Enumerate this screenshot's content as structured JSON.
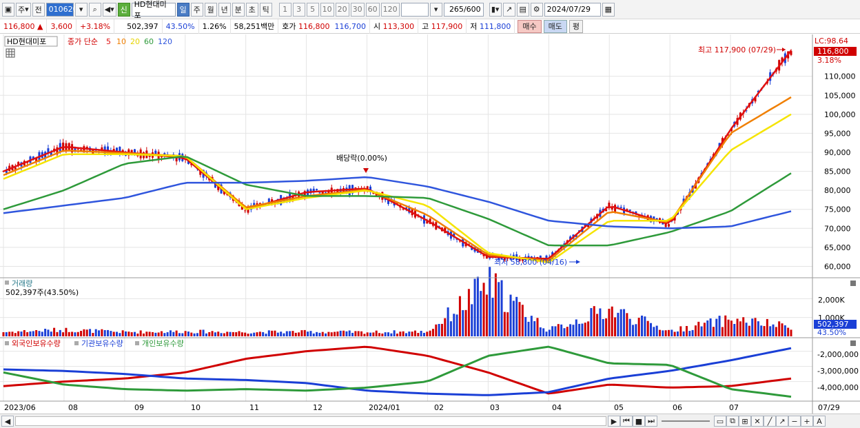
{
  "toolbar": {
    "market_type": "주",
    "prev_label": "전",
    "stock_code": "010620",
    "new_badge": "신",
    "stock_name": "HD현대미포",
    "periods": [
      "일",
      "주",
      "월",
      "년",
      "분",
      "초",
      "틱"
    ],
    "active_period": "일",
    "intervals": [
      "1",
      "3",
      "5",
      "10",
      "20",
      "30",
      "60",
      "120"
    ],
    "count_value": "265",
    "count_max": "/600",
    "date_value": "2024/07/29"
  },
  "quote": {
    "price": "116,800",
    "change_arrow": "▲",
    "change": "3,600",
    "change_pct": "+3.18%",
    "volume": "502,397",
    "volume_ratio": "43.50%",
    "turnover": "1.26%",
    "amount": "58,251백만",
    "ask_label": "호가",
    "ask1": "116,800",
    "ask2": "116,700",
    "open_label": "시",
    "open": "113,300",
    "high_label": "고",
    "high": "117,900",
    "low_label": "저",
    "low": "111,800",
    "buy_label": "매수",
    "sell_label": "매도",
    "flat_label": "평"
  },
  "price_panel": {
    "name_tag": "HD현대미포",
    "legend_prefix": "종가 단순",
    "ma_labels": [
      "5",
      "10",
      "20",
      "60",
      "120"
    ],
    "lc_label": "LC:98.64",
    "last_price_tag": "116,800",
    "last_pct_tag": "3.18%",
    "high_annotation": "최고 117,900 (07/29)",
    "low_annotation": "최저 58,800 (04/16)",
    "dividend_annotation": "배당락(0.00%)"
  },
  "volume_panel": {
    "title": "거래량",
    "value_line": "502,397주(43.50%)",
    "axis_ticks": [
      "2,000K",
      "1,000K"
    ],
    "last_tag": "502,397",
    "last_pct_tag": "43.50%"
  },
  "holding_panel": {
    "legend": [
      "외국인보유수량",
      "기관보유수량",
      "개인보유수량"
    ],
    "axis_ticks": [
      "-2,000,000",
      "-3,000,000",
      "-4,000,000"
    ]
  },
  "x_axis": {
    "labels": [
      "2023/06",
      "08",
      "09",
      "10",
      "11",
      "12",
      "2024/01",
      "02",
      "03",
      "04",
      "05",
      "06",
      "07"
    ],
    "current_label": "07/29"
  },
  "colors": {
    "up": "#d00000",
    "down": "#1a3fd6",
    "ma5": "#e01010",
    "ma10": "#f07f00",
    "ma20": "#f5e400",
    "ma60": "#2e9a3a",
    "ma120": "#2f55dd"
  },
  "chart_data": [
    {
      "type": "line",
      "title": "",
      "y_ticks": [
        60000,
        65000,
        70000,
        75000,
        80000,
        85000,
        90000,
        95000,
        100000,
        105000,
        110000
      ],
      "ylim": [
        57000,
        121000
      ],
      "x": [
        "2023/06",
        "08",
        "09",
        "10",
        "11",
        "12",
        "2024/01",
        "02",
        "03",
        "04",
        "05",
        "06",
        "07",
        "07/29"
      ],
      "series": [
        {
          "name": "5",
          "values": [
            85000,
            91500,
            90000,
            88500,
            75000,
            79500,
            80500,
            72000,
            62500,
            62000,
            76000,
            71000,
            96000,
            116800
          ]
        },
        {
          "name": "10",
          "values": [
            84000,
            90500,
            89800,
            89000,
            75500,
            78500,
            80200,
            73500,
            63000,
            61500,
            74500,
            71500,
            95000,
            104500
          ]
        },
        {
          "name": "20",
          "values": [
            83000,
            89500,
            89500,
            89000,
            75000,
            78000,
            80000,
            76000,
            63500,
            61000,
            72000,
            72000,
            90500,
            100000
          ]
        },
        {
          "name": "60",
          "values": [
            75000,
            80000,
            87000,
            89000,
            81500,
            78500,
            78500,
            78000,
            72500,
            65500,
            65500,
            69000,
            74500,
            84500
          ]
        },
        {
          "name": "120",
          "values": [
            74000,
            76000,
            78000,
            82000,
            82000,
            82500,
            83500,
            81000,
            77000,
            72000,
            70500,
            70000,
            70500,
            74500
          ]
        }
      ],
      "annotations": {
        "high": 117900,
        "low": 58800
      }
    },
    {
      "type": "bar",
      "title": "",
      "series_name": "",
      "y_ticks": [
        1000000,
        2000000
      ],
      "x": [
        "2023/06",
        "08",
        "09",
        "10",
        "11",
        "12",
        "2024/01",
        "02",
        "03",
        "04",
        "05",
        "06",
        "07",
        "07/29"
      ],
      "values": [
        230000,
        350000,
        230000,
        260000,
        230000,
        240000,
        220000,
        250000,
        2800000,
        320000,
        1450000,
        280000,
        900000,
        502397
      ]
    },
    {
      "type": "line",
      "title": "",
      "y_ticks": [
        -2000000,
        -3000000,
        -4000000
      ],
      "ylim": [
        -5200000,
        -1200000
      ],
      "x": [
        "2023/06",
        "08",
        "09",
        "10",
        "11",
        "12",
        "2024/01",
        "02",
        "03",
        "04",
        "05",
        "06",
        "07",
        "07/29"
      ],
      "series": [
        {
          "name": "외국인보유수량",
          "values": [
            -4300000,
            -4000000,
            -3800000,
            -3400000,
            -2500000,
            -2000000,
            -1700000,
            -2300000,
            -3400000,
            -4800000,
            -4200000,
            -4400000,
            -4300000,
            -3800000
          ]
        },
        {
          "name": "기관보유수량",
          "values": [
            -3200000,
            -3300000,
            -3500000,
            -3800000,
            -3900000,
            -4100000,
            -4600000,
            -4800000,
            -4900000,
            -4700000,
            -3800000,
            -3300000,
            -2600000,
            -1800000
          ]
        },
        {
          "name": "개인보유수량",
          "values": [
            -3400000,
            -4200000,
            -4500000,
            -4600000,
            -4500000,
            -4600000,
            -4400000,
            -4000000,
            -2300000,
            -1700000,
            -2800000,
            -2900000,
            -4500000,
            -5000000
          ]
        }
      ]
    }
  ]
}
